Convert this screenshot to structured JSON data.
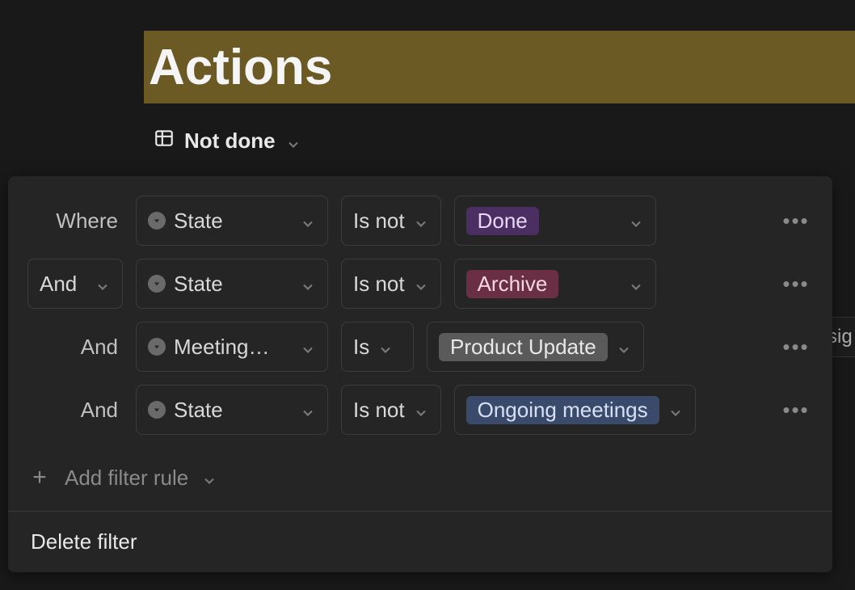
{
  "title": "Actions",
  "view": {
    "name": "Not done"
  },
  "bg_column_fragment": "sig",
  "filter": {
    "rules": [
      {
        "conjunction_label": "Where",
        "conjunction_is_dropdown": false,
        "property": "State",
        "operator": "Is not",
        "value": "Done",
        "value_color": "purple"
      },
      {
        "conjunction_label": "And",
        "conjunction_is_dropdown": true,
        "property": "State",
        "operator": "Is not",
        "value": "Archive",
        "value_color": "maroon"
      },
      {
        "conjunction_label": "And",
        "conjunction_is_dropdown": false,
        "property": "Meeting…",
        "operator": "Is",
        "value": "Product Update",
        "value_color": "gray"
      },
      {
        "conjunction_label": "And",
        "conjunction_is_dropdown": false,
        "property": "State",
        "operator": "Is not",
        "value": "Ongoing meetings",
        "value_color": "navy"
      }
    ],
    "add_label": "Add filter rule",
    "delete_label": "Delete filter"
  }
}
